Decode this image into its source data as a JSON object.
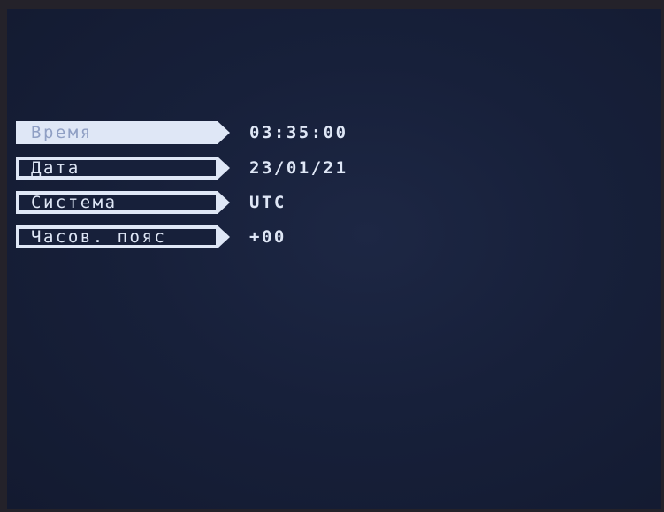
{
  "settings": {
    "items": [
      {
        "label": "Время",
        "value": "03:35:00",
        "selected": true
      },
      {
        "label": "Дата",
        "value": "23/01/21",
        "selected": false
      },
      {
        "label": "Система",
        "value": "UTC",
        "selected": false
      },
      {
        "label": "Часов. пояс",
        "value": "+00",
        "selected": false
      }
    ]
  },
  "colors": {
    "screen_background": "#17203a",
    "menu_frame": "#dfe7f6",
    "text": "#dfe7f6",
    "selected_text": "#8f9fc4"
  }
}
